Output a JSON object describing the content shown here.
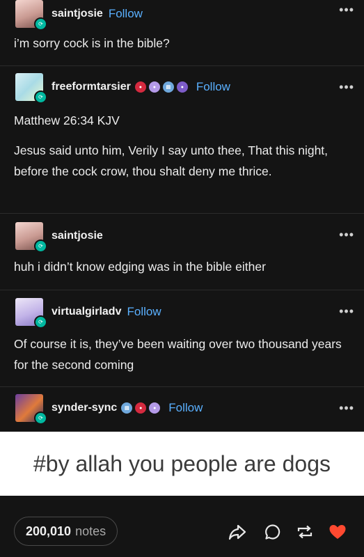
{
  "posts": [
    {
      "username": "saintjosie",
      "follow": "Follow",
      "text": "i’m sorry cock is in the bible?"
    },
    {
      "username": "freeformtarsier",
      "follow": "Follow",
      "text1": "Matthew 26:34 KJV",
      "text2": "Jesus said unto him, Verily I say unto thee, That this night, before the cock crow, thou shalt deny me thrice."
    },
    {
      "username": "saintjosie",
      "text": "huh i didn’t know edging was in the bible either"
    },
    {
      "username": "virtualgirladv",
      "follow": "Follow",
      "text": "Of course it is, they’ve been waiting over two thousand years for the second coming"
    },
    {
      "username": "synder-sync",
      "follow": "Follow"
    }
  ],
  "caption": "#by allah you people are dogs",
  "footer": {
    "notes_count": "200,010",
    "notes_label": "notes"
  },
  "icons": [
    "more-dots-icon",
    "share-icon",
    "comment-icon",
    "reblog-icon",
    "heart-icon"
  ],
  "colors": {
    "background": "#141414",
    "follow": "#5ab0ff",
    "heart": "#ff4930",
    "reblog_badge": "#00b8a0"
  }
}
